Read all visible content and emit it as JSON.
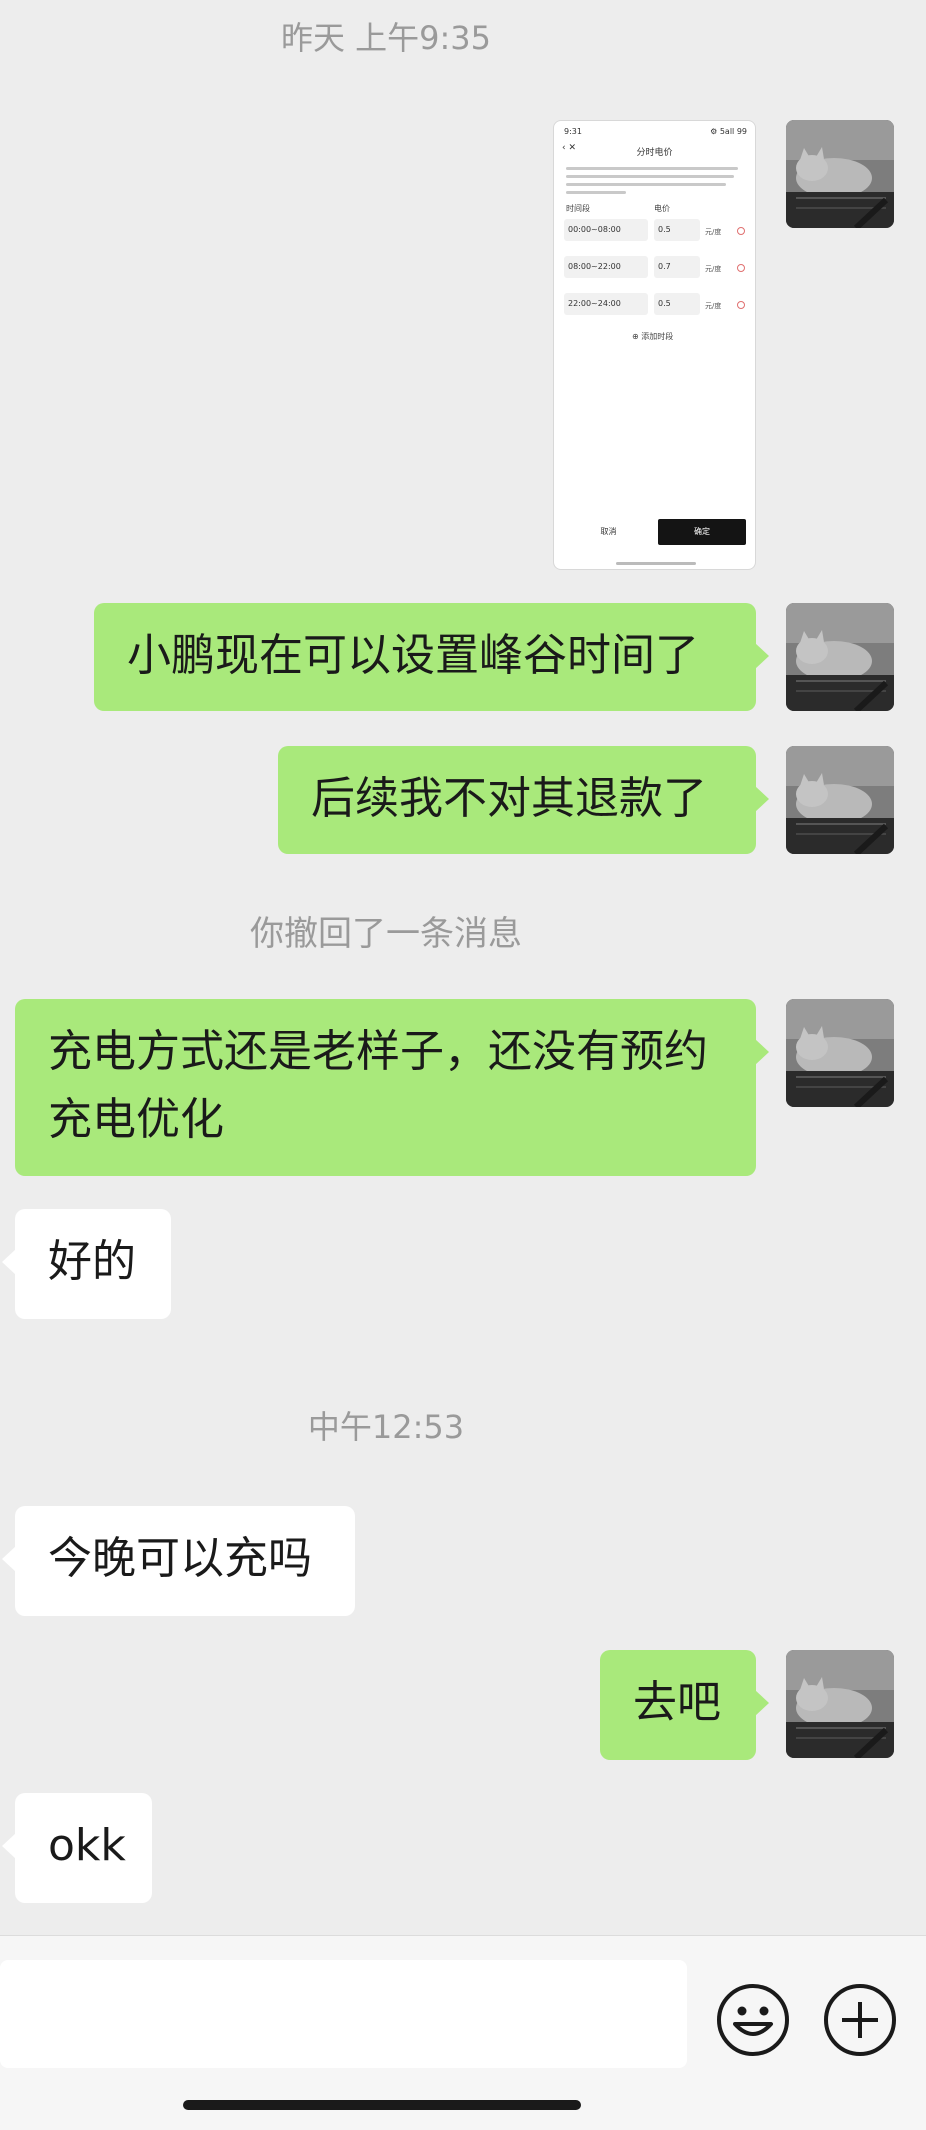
{
  "timestamps": {
    "first": "昨天 上午9:35",
    "second": "中午12:53"
  },
  "recall_notice": "你撤回了一条消息",
  "screenshot_image": {
    "status_time": "9:31",
    "status_right": "⚙ 5all 99",
    "title": "分时电价",
    "col_time": "时间段",
    "col_price": "电价",
    "rows": [
      {
        "time": "00:00~08:00",
        "price": "0.5",
        "unit": "元/度"
      },
      {
        "time": "08:00~22:00",
        "price": "0.7",
        "unit": "元/度"
      },
      {
        "time": "22:00~24:00",
        "price": "0.5",
        "unit": "元/度"
      }
    ],
    "add_label": "⊕ 添加时段",
    "cancel": "取消",
    "confirm": "确定"
  },
  "messages": [
    {
      "side": "right",
      "text": "小鹏现在可以设置峰谷时间了"
    },
    {
      "side": "right",
      "text": "后续我不对其退款了"
    },
    {
      "side": "right",
      "text": "充电方式还是老样子，还没有预约充电优化"
    },
    {
      "side": "left",
      "text": "好的"
    },
    {
      "side": "left",
      "text": "今晚可以充吗"
    },
    {
      "side": "right",
      "text": "去吧"
    },
    {
      "side": "left",
      "text": "okk"
    }
  ],
  "composer": {
    "input_value": "",
    "emoji_icon": "emoji-icon",
    "plus_icon": "plus-icon"
  },
  "colors": {
    "background": "#ededed",
    "bubble_self": "#a9e97b",
    "bubble_other": "#ffffff"
  }
}
